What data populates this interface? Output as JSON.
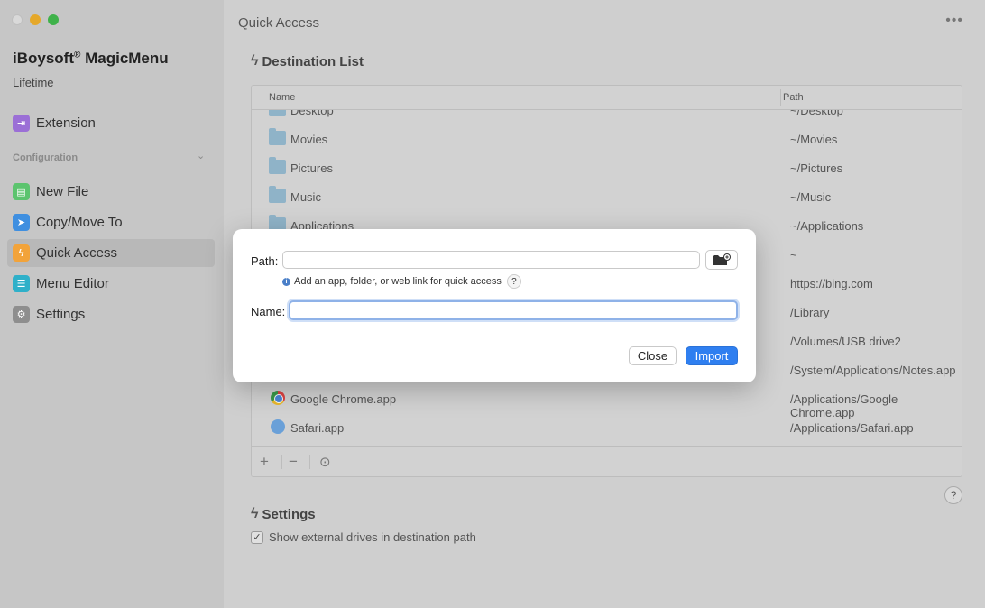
{
  "sidebar": {
    "app_name": "iBoysoft",
    "app_reg": "®",
    "app_name_suffix": " MagicMenu",
    "license": "Lifetime",
    "section_label": "Configuration",
    "items": [
      {
        "label": "Extension",
        "icon": "extension-icon",
        "color": "#9b6fd6"
      },
      {
        "label": "New File",
        "icon": "new-file-icon",
        "color": "#5cc46e"
      },
      {
        "label": "Copy/Move To",
        "icon": "send-icon",
        "color": "#3f8fe0"
      },
      {
        "label": "Quick Access",
        "icon": "lightning-icon",
        "color": "#f2a33a"
      },
      {
        "label": "Menu Editor",
        "icon": "list-icon",
        "color": "#2fb0c9"
      },
      {
        "label": "Settings",
        "icon": "gear-icon",
        "color": "#8e8e8e"
      }
    ]
  },
  "main": {
    "title": "Quick Access",
    "more": "•••",
    "destination_heading": "Destination List",
    "settings_heading": "Settings",
    "table": {
      "columns": [
        "Name",
        "Path"
      ],
      "rows": [
        {
          "name": "Desktop",
          "path": "~/Desktop",
          "icon": "folder-icon"
        },
        {
          "name": "Movies",
          "path": "~/Movies",
          "icon": "folder-icon"
        },
        {
          "name": "Pictures",
          "path": "~/Pictures",
          "icon": "folder-icon"
        },
        {
          "name": "Music",
          "path": "~/Music",
          "icon": "folder-icon"
        },
        {
          "name": "Applications",
          "path": "~/Applications",
          "icon": "folder-icon"
        },
        {
          "name": "",
          "path": "~",
          "icon": ""
        },
        {
          "name": "",
          "path": "https://bing.com",
          "icon": ""
        },
        {
          "name": "",
          "path": "/Library",
          "icon": ""
        },
        {
          "name": "",
          "path": "/Volumes/USB drive2",
          "icon": ""
        },
        {
          "name": "",
          "path": "/System/Applications/Notes.app",
          "icon": ""
        },
        {
          "name": "Google Chrome.app",
          "path": "/Applications/Google Chrome.app",
          "icon": "chrome-icon"
        },
        {
          "name": "Safari.app",
          "path": "/Applications/Safari.app",
          "icon": "safari-icon"
        }
      ],
      "add": "+",
      "remove": "−",
      "reveal": "⊙"
    },
    "help": "?",
    "show_external_label": "Show external drives in destination path",
    "show_external_checked": "✓"
  },
  "dialog": {
    "path_label": "Path:",
    "path_value": "",
    "hint": "Add an app, folder, or web link for quick access",
    "hint_help": "?",
    "info": "i",
    "name_label": "Name:",
    "name_value": "",
    "close_label": "Close",
    "import_label": "Import",
    "accent": "#2f7ff0"
  }
}
